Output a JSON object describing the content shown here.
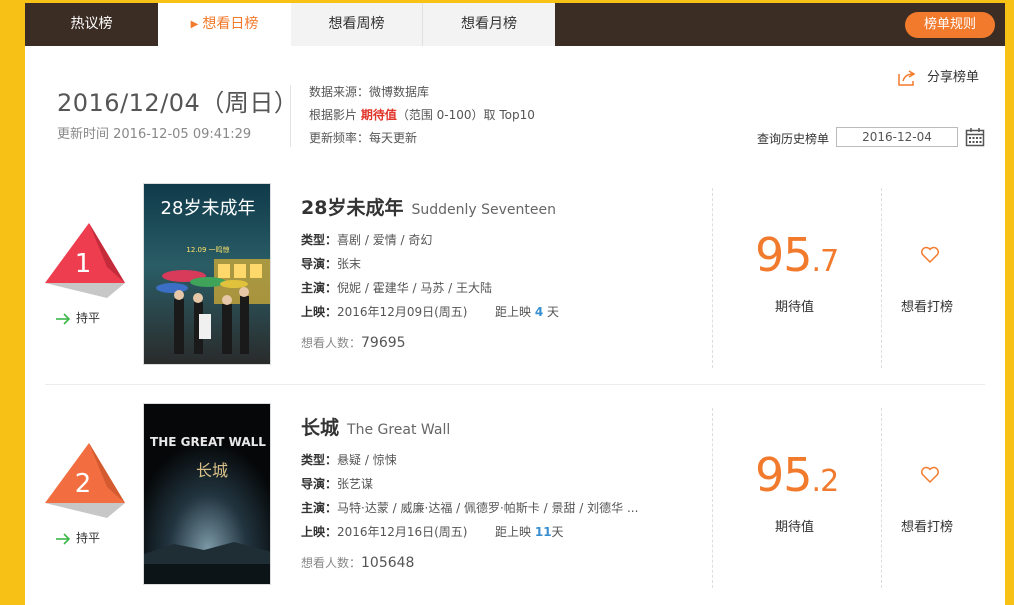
{
  "tabs": [
    {
      "label": "热议榜"
    },
    {
      "label": "想看日榜"
    },
    {
      "label": "想看周榜"
    },
    {
      "label": "想看月榜"
    }
  ],
  "rules_button": "榜单规则",
  "header": {
    "date": "2016/12/04（周日）",
    "update_time": "更新时间 2016-12-05 09:41:29",
    "source": "数据来源：微博数据库",
    "basis_prefix": "根据影片",
    "basis_highlight": "期待值",
    "basis_suffix": "（范围 0-100）取 Top10",
    "frequency": "更新频率：每天更新",
    "share_label": "分享榜单",
    "history_label": "查询历史榜单",
    "history_date": "2016-12-04"
  },
  "ranks": [
    {
      "rank": "1",
      "trend": "持平",
      "title": "28岁未成年",
      "title_en": "Suddenly Seventeen",
      "genre_label": "类型：",
      "genre": "喜剧 / 爱情 / 奇幻",
      "director_label": "导演：",
      "director": "张末",
      "cast_label": "主演：",
      "cast": "倪妮 / 霍建华 / 马苏 / 王大陆",
      "release_label": "上映：",
      "release": "2016年12月09日(周五)",
      "countdown_prefix": "距上映",
      "countdown_days": "4",
      "countdown_suffix": "天",
      "viewers_label": "想看人数：",
      "viewers": "79695",
      "score_int": "95",
      "score_dec": ".7",
      "score_label": "期待值",
      "want_label": "想看打榜",
      "poster_title": "28岁未成年",
      "poster_date": "12.09 一鸣惊"
    },
    {
      "rank": "2",
      "trend": "持平",
      "title": "长城",
      "title_en": "The Great Wall",
      "genre_label": "类型：",
      "genre": "悬疑 / 惊悚",
      "director_label": "导演：",
      "director": "张艺谋",
      "cast_label": "主演：",
      "cast": "马特·达蒙 / 威廉·达福 / 佩德罗·帕斯卡 / 景甜 / 刘德华 ...",
      "release_label": "上映：",
      "release": "2016年12月16日(周五)",
      "countdown_prefix": "距上映",
      "countdown_days": "11",
      "countdown_suffix": "天",
      "viewers_label": "想看人数：",
      "viewers": "105648",
      "score_int": "95",
      "score_dec": ".2",
      "score_label": "期待值",
      "want_label": "想看打榜",
      "poster_title": "THE GREAT WALL",
      "poster_cn": "长城"
    }
  ],
  "colors": {
    "accent": "#f27a2c",
    "rank1": "#ee3d4e",
    "rank2": "#f26e41",
    "tabbar": "#3b2d23",
    "background": "#f7c215",
    "trend_arrow": "#3cb84a",
    "days": "#3a8fd0"
  }
}
